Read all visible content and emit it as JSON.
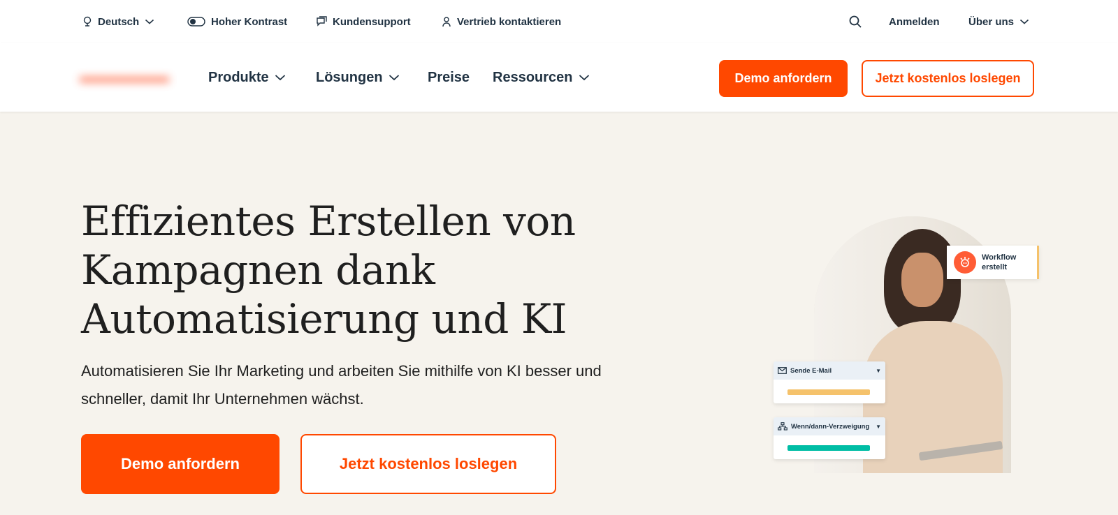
{
  "utility_bar": {
    "language": "Deutsch",
    "high_contrast": "Hoher Kontrast",
    "support": "Kundensupport",
    "sales": "Vertrieb kontaktieren",
    "login": "Anmelden",
    "about": "Über uns"
  },
  "nav": {
    "items": [
      "Produkte",
      "Lösungen",
      "Preise",
      "Ressourcen"
    ],
    "demo_button": "Demo anfordern",
    "free_button": "Jetzt kostenlos loslegen"
  },
  "hero": {
    "title_lines": [
      "Effizientes Erstellen von",
      "Kampagnen dank",
      "Automatisierung und KI"
    ],
    "subtitle": "Automatisieren Sie Ihr Marketing und arbeiten Sie mithilfe von KI besser und schneller, damit Ihr Unternehmen wächst.",
    "demo_button": "Demo anfordern",
    "free_button": "Jetzt kostenlos loslegen"
  },
  "illustration": {
    "badge_text": "Workflow erstellt",
    "card_email": "Sende E-Mail",
    "card_branch": "Wenn/dann-Verzweigung"
  },
  "icons": {
    "language": "globe-icon",
    "contrast": "contrast-toggle-icon",
    "support": "chat-icon",
    "sales": "person-icon",
    "search": "search-icon",
    "chevron": "chevron-down-icon",
    "email": "envelope-icon",
    "branch": "branch-icon",
    "badge": "sprocket-avatar-icon"
  },
  "colors": {
    "brand": "#ff4800",
    "text": "#213343",
    "hero_bg": "#f6f3ed",
    "email_bar": "#f5c26b",
    "branch_bar": "#00bda5"
  }
}
